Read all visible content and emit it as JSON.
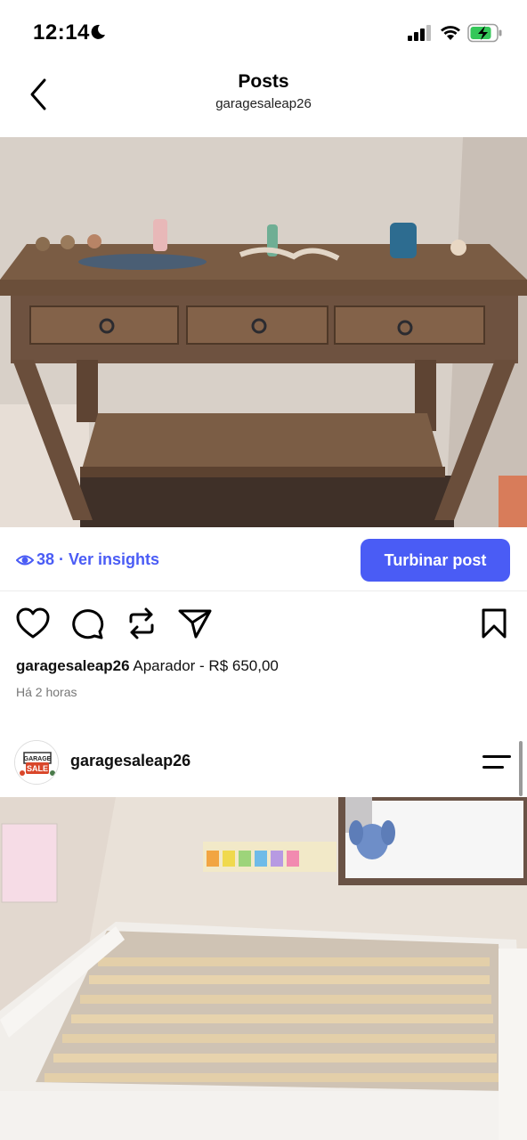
{
  "status_bar": {
    "time": "12:14"
  },
  "header": {
    "title": "Posts",
    "subtitle": "garagesaleap26"
  },
  "post1": {
    "views": "38 · Ver insights",
    "boost_label": "Turbinar post",
    "caption_user": "garagesaleap26",
    "caption_text": "Aparador - R$ 650,00",
    "timestamp": "Há 2 horas"
  },
  "post2": {
    "username": "garagesaleap26",
    "avatar_text": [
      "GARAGE",
      "SALE"
    ]
  },
  "colors": {
    "accent": "#4a5cf5",
    "battery": "#34c759"
  }
}
